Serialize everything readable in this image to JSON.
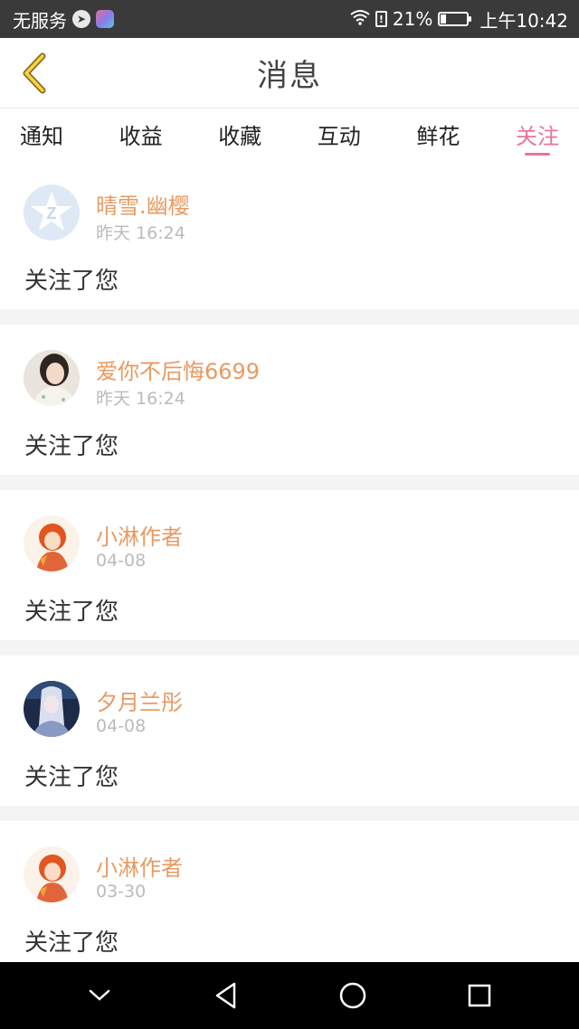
{
  "status_bar": {
    "carrier": "无服务",
    "battery_percent": "21%",
    "battery_level": 0.21,
    "time": "上午10:42",
    "icons": [
      "navigation-icon",
      "app-icon",
      "wifi-icon",
      "sim-alert-icon",
      "battery-icon"
    ]
  },
  "header": {
    "title": "消息",
    "back_icon": "chevron-left-icon"
  },
  "tabs": [
    {
      "label": "通知"
    },
    {
      "label": "收益"
    },
    {
      "label": "收藏"
    },
    {
      "label": "互动"
    },
    {
      "label": "鲜花"
    },
    {
      "label": "关注"
    }
  ],
  "active_tab": "关注",
  "messages": [
    {
      "user": "晴雪.幽樱",
      "time": "昨天 16:24",
      "text": "关注了您",
      "avatar": "default-avatar"
    },
    {
      "user": "爱你不后悔6699",
      "time": "昨天 16:24",
      "text": "关注了您",
      "avatar": "girl-photo-avatar"
    },
    {
      "user": "小淋作者",
      "time": "04-08",
      "text": "关注了您",
      "avatar": "anime-avatar"
    },
    {
      "user": "夕月兰彤",
      "time": "04-08",
      "text": "关注了您",
      "avatar": "anime-dark-avatar"
    },
    {
      "user": "小淋作者",
      "time": "03-30",
      "text": "关注了您",
      "avatar": "anime-avatar"
    }
  ],
  "nav_bar": {
    "icons": [
      "chevron-down-icon",
      "back-triangle-icon",
      "home-circle-icon",
      "recents-square-icon"
    ]
  },
  "colors": {
    "accent": "#e8739e",
    "username": "#e89a62",
    "status_bar_bg": "#3a3a3a"
  }
}
